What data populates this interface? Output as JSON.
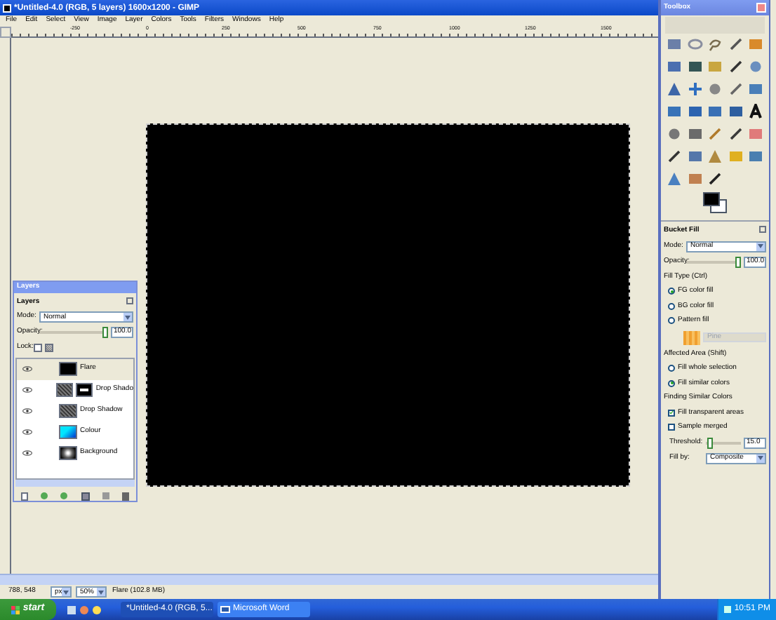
{
  "window": {
    "title": "*Untitled-4.0 (RGB, 5 layers) 1600x1200 - GIMP"
  },
  "menu": [
    "File",
    "Edit",
    "Select",
    "View",
    "Image",
    "Layer",
    "Colors",
    "Tools",
    "Filters",
    "Windows",
    "Help"
  ],
  "ruler": {
    "labels": [
      "-250",
      "0",
      "250",
      "500",
      "750",
      "1000",
      "1250",
      "1500"
    ]
  },
  "layers_dialog": {
    "title": "Layers",
    "header": "Layers",
    "mode_label": "Mode:",
    "mode": "Normal",
    "opacity_label": "Opacity:",
    "opacity": "100.0",
    "opacity_slider": {
      "level": 1
    },
    "lock_label": "Lock:",
    "locks": [
      {
        "kind": "pixels",
        "checked": false
      },
      {
        "kind": "alpha",
        "checked": false
      }
    ],
    "layers": [
      {
        "name": "Flare",
        "kind": "black",
        "selected": true,
        "visible": true
      },
      {
        "name": "Drop Shado",
        "kind": "noise_mask",
        "selected": false,
        "visible": true
      },
      {
        "name": "Drop Shadow",
        "kind": "noise",
        "selected": false,
        "visible": true
      },
      {
        "name": "Colour",
        "kind": "cyan",
        "selected": false,
        "visible": true
      },
      {
        "name": "Background",
        "kind": "glow",
        "selected": false,
        "visible": true
      }
    ]
  },
  "status_bar": {
    "coords": "788, 548",
    "unit": "px",
    "zoom": "50%",
    "info": "Flare (102.8 MB)"
  },
  "toolbox": {
    "title": "Toolbox",
    "tool_options": {
      "title": "Bucket Fill",
      "mode_label": "Mode:",
      "mode": "Normal",
      "opacity_label": "Opacity:",
      "opacity": "100.0",
      "opacity_slider": {
        "level": 1
      },
      "fill_type_label": "Fill Type  (Ctrl)",
      "fill_types": [
        {
          "label": "FG color fill",
          "selected": true
        },
        {
          "label": "BG color fill",
          "selected": false
        },
        {
          "label": "Pattern fill",
          "selected": false
        }
      ],
      "pattern": "Pine",
      "affected_label": "Affected Area  (Shift)",
      "affected": [
        {
          "label": "Fill whole selection",
          "selected": false
        },
        {
          "label": "Fill similar colors",
          "selected": true
        }
      ],
      "similar_label": "Finding Similar Colors",
      "options": [
        {
          "label": "Fill transparent areas",
          "checked": true
        },
        {
          "label": "Sample merged",
          "checked": false
        }
      ],
      "threshold_label": "Threshold:",
      "threshold": "15.0",
      "threshold_slider": {
        "level": 0.06
      },
      "fill_by_label": "Fill by:",
      "fill_by": "Composite"
    }
  },
  "taskbar": {
    "start": "start",
    "tasks": [
      {
        "label": "*Untitled-4.0 (RGB, 5...",
        "selected": true
      },
      {
        "label": "Microsoft Word",
        "selected": false
      }
    ],
    "clock": "10:51 PM"
  }
}
